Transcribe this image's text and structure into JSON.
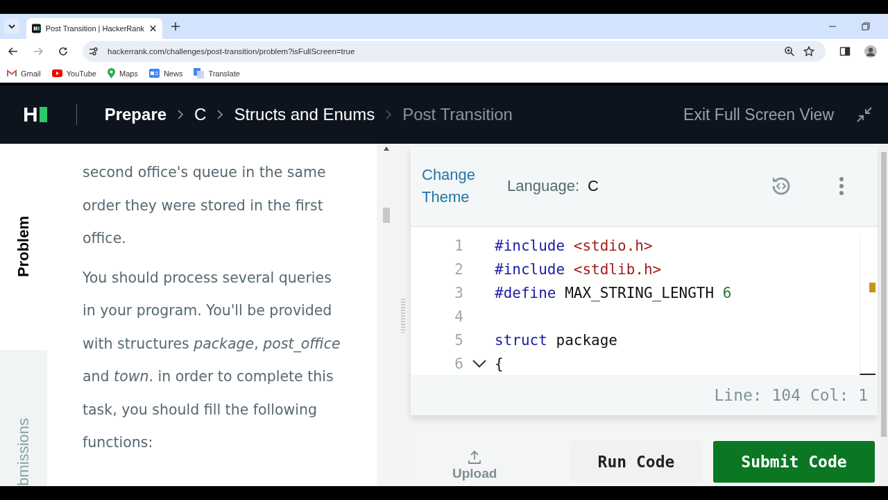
{
  "browser": {
    "tab": {
      "title": "Post Transition | HackerRank"
    },
    "url": "hackerrank.com/challenges/post-transition/problem?isFullScreen=true",
    "bookmarks": [
      {
        "label": "Gmail",
        "kind": "gmail"
      },
      {
        "label": "YouTube",
        "kind": "youtube"
      },
      {
        "label": "Maps",
        "kind": "maps"
      },
      {
        "label": "News",
        "kind": "news"
      },
      {
        "label": "Translate",
        "kind": "translate"
      }
    ]
  },
  "header": {
    "logo": "H",
    "breadcrumbs": [
      {
        "label": "Prepare",
        "kind": "root"
      },
      {
        "label": "C",
        "kind": "link"
      },
      {
        "label": "Structs and Enums",
        "kind": "link"
      },
      {
        "label": "Post Transition",
        "kind": "current"
      }
    ],
    "exit": "Exit Full Screen View"
  },
  "side_tabs": [
    {
      "label": "Problem",
      "selected": true
    },
    {
      "label": "bmissions",
      "selected": false
    }
  ],
  "problem": {
    "paragraphs": [
      "second office's queue in the same order they were stored in the first office.",
      "You should process several queries in your program. You'll be provided with structures *package*, *post_office* and *town*. in order to complete this task, you should fill the following functions:"
    ]
  },
  "editor": {
    "change_theme": "Change Theme",
    "language_label": "Language:",
    "language": "C",
    "lines": [
      {
        "number": "1",
        "kind": "code",
        "tokens": [
          {
            "kind": "keyword",
            "text": "#include"
          },
          {
            "kind": "string",
            "text": " <stdio.h>"
          }
        ]
      },
      {
        "number": "2",
        "kind": "code",
        "tokens": [
          {
            "kind": "keyword",
            "text": "#include"
          },
          {
            "kind": "string",
            "text": " <stdlib.h>"
          }
        ]
      },
      {
        "number": "3",
        "kind": "code",
        "tokens": [
          {
            "kind": "keyword",
            "text": "#define"
          },
          {
            "kind": "plain",
            "text": " MAX_STRING_LENGTH "
          },
          {
            "kind": "number",
            "text": "6"
          }
        ]
      },
      {
        "number": "4",
        "kind": "code"
      },
      {
        "number": "5",
        "kind": "code",
        "tokens": [
          {
            "kind": "keyword",
            "text": "struct"
          },
          {
            "kind": "plain",
            "text": " package"
          }
        ]
      },
      {
        "number": "6",
        "kind": "fold_start",
        "tokens": [
          {
            "kind": "plain",
            "text": "{"
          }
        ]
      }
    ],
    "status": "Line: 104 Col: 1"
  },
  "actions": {
    "upload": "Upload",
    "run": "Run Code",
    "submit": "Submit Code"
  }
}
